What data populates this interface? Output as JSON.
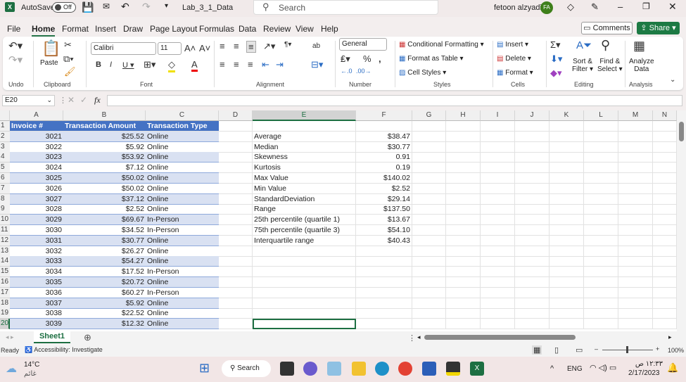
{
  "titlebar": {
    "autosave": "AutoSave",
    "toggle": "Off",
    "filename": "Lab_3_1_Data",
    "search": "Search",
    "user": "fetoon alzyadi",
    "initials": "FA"
  },
  "menu": [
    "File",
    "Home",
    "Format",
    "Insert",
    "Draw",
    "Page Layout",
    "Formulas",
    "Data",
    "Review",
    "View",
    "Help"
  ],
  "actions": {
    "comments": "Comments",
    "share": "Share"
  },
  "ribbon": {
    "groups": {
      "undo": "Undo",
      "clipboard": "Clipboard",
      "font": "Font",
      "alignment": "Alignment",
      "number": "Number",
      "styles": "Styles",
      "cells": "Cells",
      "editing": "Editing",
      "analysis": "Analysis"
    },
    "paste": "Paste",
    "font_name": "Calibri",
    "font_size": "11",
    "number_format": "General",
    "conditional": "Conditional Formatting",
    "format_table": "Format as Table",
    "cell_styles": "Cell Styles",
    "insert": "Insert",
    "delete": "Delete",
    "format": "Format",
    "sort": "Sort &",
    "filter": "Filter",
    "find": "Find &",
    "select": "Select",
    "analyze": "Analyze",
    "data": "Data"
  },
  "formula_bar": {
    "name_box": "E20",
    "fx": "fx",
    "value": ""
  },
  "columns": [
    "A",
    "B",
    "C",
    "D",
    "E",
    "F",
    "G",
    "H",
    "I",
    "J",
    "K",
    "L",
    "M",
    "N"
  ],
  "table": {
    "headers": [
      "Invoice #",
      "Transaction Amount",
      "Transaction Type"
    ],
    "rows": [
      [
        "3021",
        "$25.52",
        "Online"
      ],
      [
        "3022",
        "$5.92",
        "Online"
      ],
      [
        "3023",
        "$53.92",
        "Online"
      ],
      [
        "3024",
        "$7.12",
        "Online"
      ],
      [
        "3025",
        "$50.02",
        "Online"
      ],
      [
        "3026",
        "$50.02",
        "Online"
      ],
      [
        "3027",
        "$37.12",
        "Online"
      ],
      [
        "3028",
        "$2.52",
        "Online"
      ],
      [
        "3029",
        "$69.67",
        "In-Person"
      ],
      [
        "3030",
        "$34.52",
        "In-Person"
      ],
      [
        "3031",
        "$30.77",
        "Online"
      ],
      [
        "3032",
        "$26.27",
        "Online"
      ],
      [
        "3033",
        "$54.27",
        "Online"
      ],
      [
        "3034",
        "$17.52",
        "In-Person"
      ],
      [
        "3035",
        "$20.72",
        "Online"
      ],
      [
        "3036",
        "$60.27",
        "In-Person"
      ],
      [
        "3037",
        "$5.92",
        "Online"
      ],
      [
        "3038",
        "$22.52",
        "Online"
      ],
      [
        "3039",
        "$12.32",
        "Online"
      ]
    ]
  },
  "stats": [
    [
      "Average",
      "$38.47"
    ],
    [
      "Median",
      "$30.77"
    ],
    [
      "Skewness",
      "0.91"
    ],
    [
      "Kurtosis",
      "0.19"
    ],
    [
      "Max Value",
      "$140.02"
    ],
    [
      "Min Value",
      "$2.52"
    ],
    [
      "StandardDeviation",
      "$29.14"
    ],
    [
      "Range",
      "$137.50"
    ],
    [
      "25th percentile (quartile 1)",
      "$13.67"
    ],
    [
      "75th percentile (quartile 3)",
      "$54.10"
    ],
    [
      "Interquartile range",
      "$40.43"
    ]
  ],
  "sheet_tab": "Sheet1",
  "status": {
    "ready": "Ready",
    "accessibility": "Accessibility: Investigate",
    "zoom": "100%"
  },
  "taskbar": {
    "temp": "14°C",
    "weather": "غائم",
    "search": "Search",
    "lang": "ENG",
    "time": "١٢:٣٣ ص",
    "date": "2/17/2023"
  },
  "colors": {
    "excel_green": "#1d6f42",
    "table_header": "#4472c4",
    "table_band": "#d9e1f2"
  }
}
